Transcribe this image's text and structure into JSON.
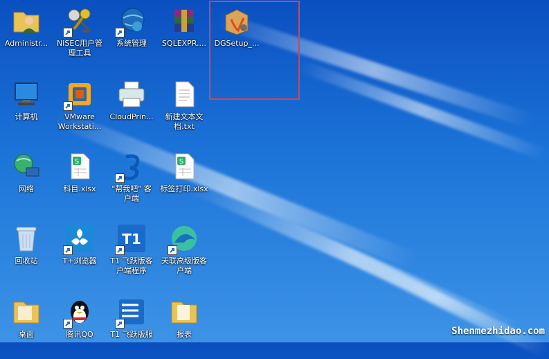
{
  "desktop": {
    "icons": [
      {
        "label": "Administr..."
      },
      {
        "label": "NISEC用户管\n理工具"
      },
      {
        "label": "系统管理"
      },
      {
        "label": "SQLEXPR...."
      },
      {
        "label": "DGSetup_..."
      },
      {
        "label": "计算机"
      },
      {
        "label": "VMware\nWorkstati..."
      },
      {
        "label": "CloudPrin..."
      },
      {
        "label": "新建文本文\n档.txt"
      },
      {
        "label": "网络"
      },
      {
        "label": "科目.xlsx"
      },
      {
        "label": "\"帮我吧\" 客\n户端"
      },
      {
        "label": "标签打印.xlsx"
      },
      {
        "label": "回收站"
      },
      {
        "label": "T+浏览器"
      },
      {
        "label": "T1 飞跃版客\n户端程序"
      },
      {
        "label": "天联高级版客\n户端"
      },
      {
        "label": "桌面"
      },
      {
        "label": "腾讯QQ"
      },
      {
        "label": "T1 飞跃版服"
      },
      {
        "label": "报表"
      }
    ]
  },
  "watermark": "Shenmezhidao.com"
}
